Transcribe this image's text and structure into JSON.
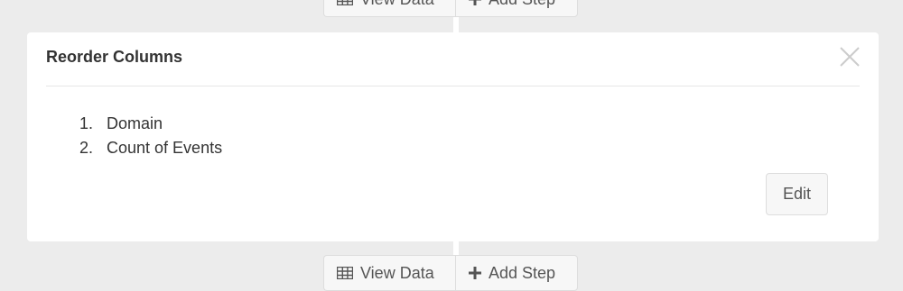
{
  "pipeline": {
    "top_actions": {
      "view_data_label": "View Data",
      "add_step_label": "Add Step"
    },
    "bottom_actions": {
      "view_data_label": "View Data",
      "add_step_label": "Add Step"
    }
  },
  "step_card": {
    "title": "Reorder Columns",
    "columns": [
      {
        "number": "1.",
        "name": "Domain"
      },
      {
        "number": "2.",
        "name": "Count of Events"
      }
    ],
    "edit_label": "Edit"
  },
  "icons": {
    "view_data": "table-grid-icon",
    "add_step": "plus-icon",
    "close": "close-icon"
  },
  "colors": {
    "background": "#ececec",
    "card": "#ffffff",
    "button_bg": "#f7f7f7",
    "button_border": "#dddddd",
    "text": "#333333",
    "close_icon": "#cccccc"
  }
}
